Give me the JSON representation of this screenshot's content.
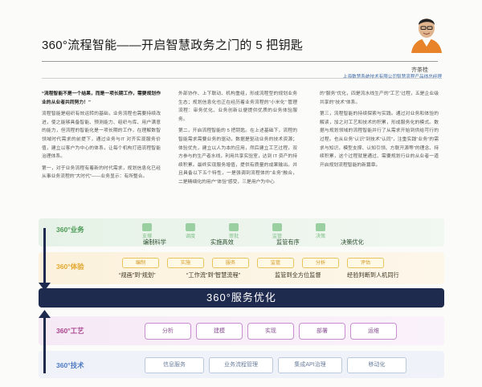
{
  "article": {
    "title": "360°流程智能——开启智慧政务之门的 5 把钥匙",
    "author_name": "齐茶桂",
    "author_title": "上海数慧系统技术有限公司智慧流程产品线总经理",
    "columns": [
      {
        "lead": "“流程智能不是一个结果，而是一项长期工作，需要规划作业的从业者共同努力！”",
        "paragraphs": [
          "流程智能是组织有效运转的基础，业务流程也需要持续改进，使之能够具备智能、预测能力、组织与库、用户满意的能力，但流程的智能化是一项长期的工作，在理解数智领域时代需求的前提下，通过业务与IT 对齐实现服务价值，建立以客户为中心的体系，让每个机构打造流程智能治理体系。",
          "第一，对于业务流程有着新的时代需求，规划信息化已经从事业务流程的“大时代”——业务显示：有所整合。"
        ]
      },
      {
        "lead": "",
        "paragraphs": [
          "外部协作、上下联动、机构重组，形成流程型的规划业务生态；规划信息化也正在经历着业务流程的“小米化”   管理流程：审务优化、业务创新以便提供优质的业务体验服务。",
          "第二，开启流程智能的 5 把钥匙。在上述基础下，流程的智能需求需要业务的驱动，数据是驱动业务的技术资源；体验优先，建立以人为本的应用，然后建立工艺过程，双方参与的生产者水线，利用共享实验室，达到 IT 资产的持续积累。最终实现服务增值，提供有质量的成果输出。并且具备以下五个特性，一是强调到流程体的“业务”融合，二是精细化的用户“体验”感受，三是用户为中心"
        ]
      },
      {
        "lead": "",
        "paragraphs": [
          "的“服务”优化，四是流水线生产的“工艺”过程，五是企业级共享的“技术”体系。",
          "第三，流程智能的持续探索与实践。通过对业务和体验的解读，加之对工艺和技术的积累，形成服务化的模式。数据与规划领域的流程智能并行了从需求开始到供给可行的过程。也从业务“认识”到技术“认同”，注重实践“业务”的需求与知识，模型支撑、认知引领、方联开源等”的理念、持续积累，这个过程就是通过、需要规划行业的从业者一道开启规划流程智能的新篇章。"
        ]
      }
    ]
  },
  "diagram": {
    "business": {
      "label": "360°业务",
      "items": [
        "支撑",
        "调度",
        "审批",
        "监管",
        "决策"
      ],
      "outcomes": [
        "编制科学",
        "实施高效",
        "监管有序",
        "决策优化"
      ]
    },
    "experience": {
      "label": "360°体验",
      "items": [
        "编制",
        "实施",
        "服务",
        "监管",
        "分析",
        "评估"
      ],
      "outcomes": [
        "“规画”到“规划”",
        "“工作流”到“智慧流程”",
        "监管到全方位监督",
        "经验判断到人机同行"
      ]
    },
    "optimization": {
      "label": "360°服务优化"
    },
    "process": {
      "label": "360°工艺",
      "items": [
        "分析",
        "建模",
        "实现",
        "部署",
        "运维"
      ]
    },
    "technology": {
      "label": "360°技术",
      "items": [
        "信息服务",
        "业务流程管理",
        "集成API治理",
        "移动化"
      ]
    },
    "colors": {
      "business": "#4a9a55",
      "experience": "#e2a930",
      "optimization": "#1f2a4f",
      "process": "#a9458f",
      "technology": "#4f7bc2"
    }
  }
}
